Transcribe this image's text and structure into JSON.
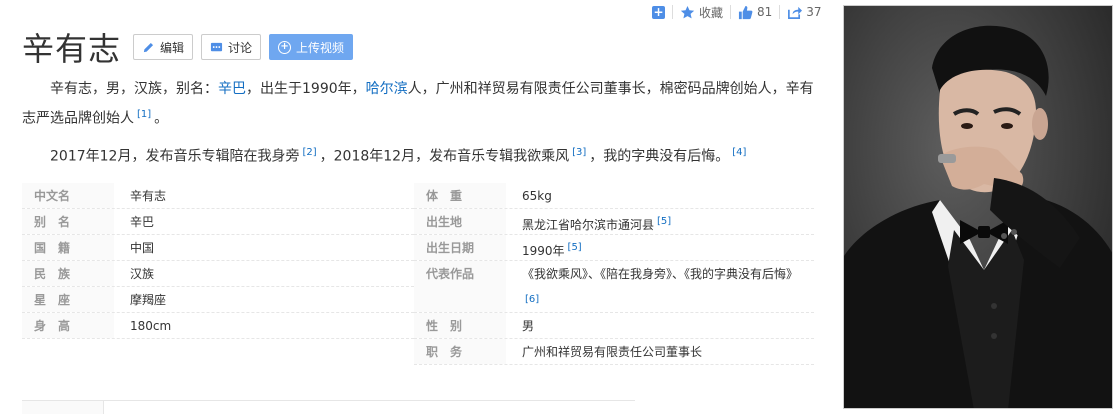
{
  "actions": {
    "favorite": "收藏",
    "like_count": "81",
    "share_count": "37"
  },
  "header": {
    "title": "辛有志",
    "edit": "编辑",
    "discuss": "讨论",
    "upload": "上传视频"
  },
  "summary": {
    "p1_a": "辛有志，男，汉族，别名：",
    "p1_alias": "辛巴",
    "p1_b": "，出生于1990年，",
    "p1_city": "哈尔滨",
    "p1_c": "人，广州和祥贸易有限责任公司董事长，棉密码品牌创始人，辛有志严选品牌创始人",
    "p1_ref": "[1]",
    "p1_end": "。",
    "p2_a": "2017年12月，发布音乐专辑陪在我身旁",
    "p2_ref2": "[2]",
    "p2_b": "，2018年12月，发布音乐专辑我欲乘风",
    "p2_ref3": "[3]",
    "p2_c": "，我的字典没有后悔。",
    "p2_ref4": "[4]"
  },
  "info": {
    "left": [
      {
        "k": "中文名",
        "v": "辛有志"
      },
      {
        "k": "别　名",
        "v": "辛巴"
      },
      {
        "k": "国　籍",
        "v": "中国"
      },
      {
        "k": "民　族",
        "v": "汉族"
      },
      {
        "k": "星　座",
        "v": "摩羯座"
      },
      {
        "k": "身　高",
        "v": "180cm"
      }
    ],
    "right": [
      {
        "k": "体　重",
        "v": "65kg",
        "ref": ""
      },
      {
        "k": "出生地",
        "v": "黑龙江省哈尔滨市通河县",
        "ref": "[5]"
      },
      {
        "k": "出生日期",
        "v": "1990年",
        "ref": "[5]"
      },
      {
        "k": "代表作品",
        "v": "《我欲乘风》、《陪在我身旁》、《我的字典没有后悔》",
        "ref": "[6]"
      },
      {
        "k": "性　别",
        "v": "男",
        "ref": ""
      },
      {
        "k": "职　务",
        "v": "广州和祥贸易有限责任公司董事长",
        "ref": ""
      }
    ]
  }
}
